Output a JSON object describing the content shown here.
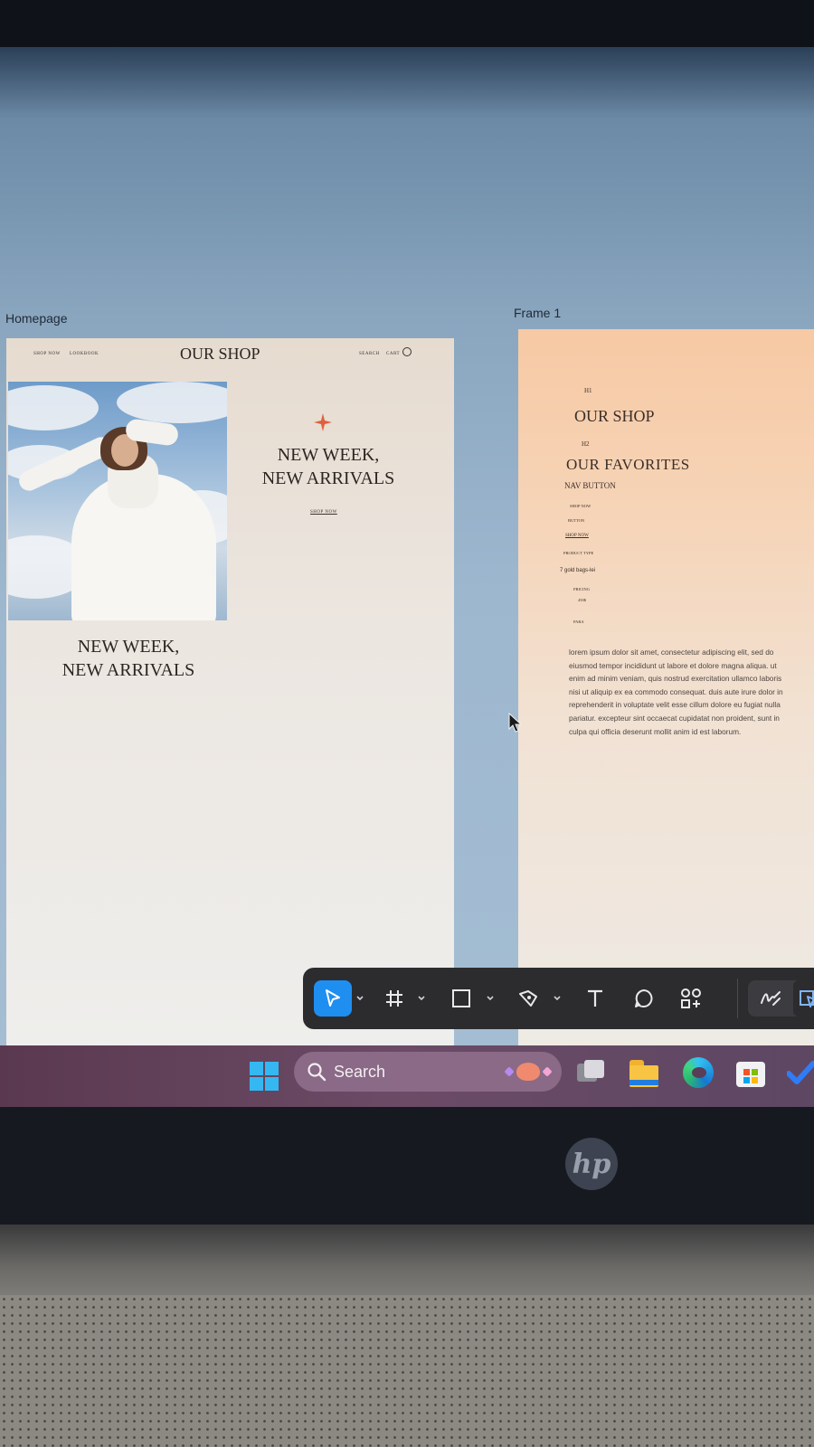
{
  "figma": {
    "frames": [
      {
        "label": "Homepage"
      },
      {
        "label": "Frame 1"
      }
    ]
  },
  "homepage": {
    "nav": {
      "shop_now": "SHOP NOW",
      "lookbook": "LOOKBOOK",
      "search": "SEARCH",
      "cart": "CART"
    },
    "logo": "OUR SHOP",
    "hero_heading_line1": "NEW WEEK,",
    "hero_heading_line2": "NEW ARRIVALS",
    "hero_cta": "SHOP NOW",
    "section_heading_line1": "NEW WEEK,",
    "section_heading_line2": "NEW ARRIVALS",
    "accent_color": "#e0603e"
  },
  "frame1": {
    "h1_label": "H1",
    "h1_sample": "OUR SHOP",
    "h2_label": "H2",
    "h2_sample": "OUR FAVORITES",
    "nav_button_label": "NAV BUTTON",
    "nav_button_sample": "SHOP NOW",
    "button_label": "BUTTON",
    "button_sample": "SHOP NOW",
    "product_type_label": "PRODUCT TYPE",
    "product_type_sample": "7 gold bags-lei",
    "pricing_label": "PRICING",
    "pricing_sample": "450$",
    "para_label": "PARA",
    "para_text": "lorem ipsum dolor sit amet, consectetur adipiscing elit, sed do eiusmod tempor incididunt ut labore et dolore magna aliqua. ut enim ad minim veniam, quis nostrud exercitation ullamco laboris nisi ut aliquip ex ea commodo consequat. duis aute irure dolor in reprehenderit in voluptate velit esse cillum dolore eu fugiat nulla pariatur. excepteur sint occaecat cupidatat non proident, sunt in culpa qui officia deserunt mollit anim id est laborum."
  },
  "toolbar": {
    "tools": [
      "move-tool",
      "frame-tool",
      "shape-tool",
      "pen-tool",
      "text-tool",
      "comment-tool",
      "actions-tool",
      "draw-tool",
      "dev-mode-tool"
    ],
    "active_tool": "move-tool",
    "active_color": "#1f8ef1"
  },
  "taskbar": {
    "search_label": "Search",
    "apps": [
      "task-view",
      "file-explorer",
      "edge",
      "microsoft-store",
      "todo"
    ]
  },
  "device": {
    "brand": "hp"
  }
}
